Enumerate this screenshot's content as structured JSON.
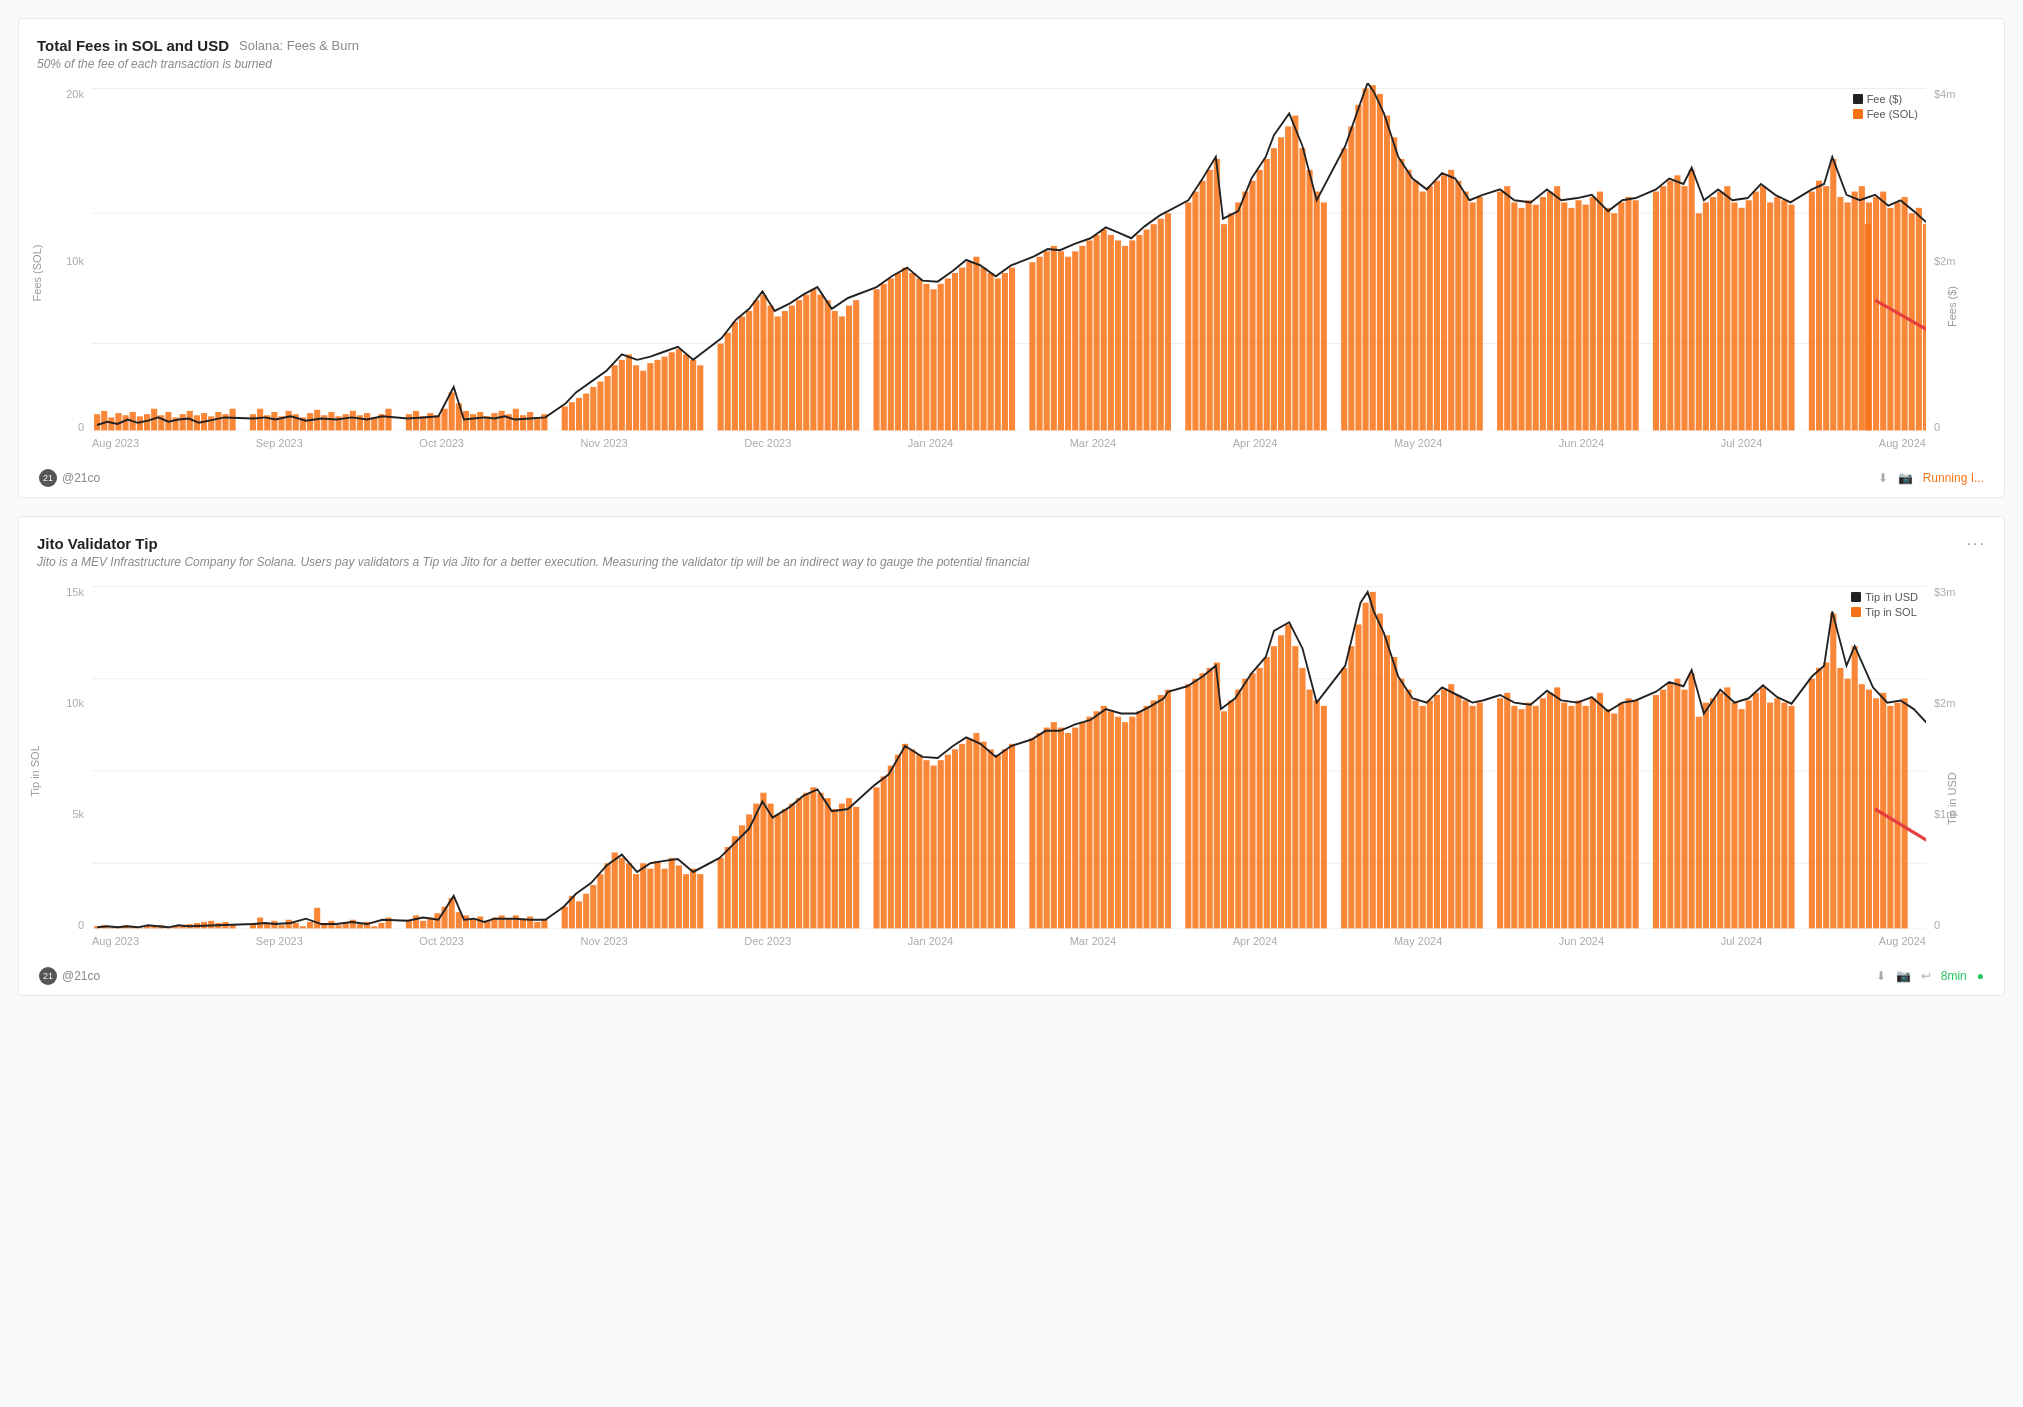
{
  "chart1": {
    "title": "Total Fees in SOL and USD",
    "tag": "Solana: Fees & Burn",
    "description": "50% of the fee of each transaction is burned",
    "yAxisLeft": {
      "label": "Fees (SOL)",
      "ticks": [
        "20k",
        "10k",
        "0"
      ]
    },
    "yAxisRight": {
      "label": "Fees ($)",
      "ticks": [
        "$4m",
        "$2m",
        "0"
      ]
    },
    "xAxisTicks": [
      "Aug 2023",
      "Sep 2023",
      "Oct 2023",
      "Nov 2023",
      "Dec 2023",
      "Jan 2024",
      "Mar 2024",
      "Apr 2024",
      "May 2024",
      "Jun 2024",
      "Jul 2024",
      "Aug 2024"
    ],
    "legend": {
      "item1": "Fee ($)",
      "item2": "Fee (SOL)"
    },
    "author": "@21co",
    "status": "Running I..."
  },
  "chart2": {
    "title": "Jito Validator Tip",
    "description": "Jito is a MEV Infrastructure Company for Solana. Users pay validators a Tip via Jito for a better execution. Measuring the validator tip will be an indirect way to gauge the potential financial",
    "yAxisLeft": {
      "label": "Tip in SOL",
      "ticks": [
        "15k",
        "10k",
        "5k",
        "0"
      ]
    },
    "yAxisRight": {
      "label": "Tip in USD",
      "ticks": [
        "$3m",
        "$2m",
        "$1m",
        "0"
      ]
    },
    "xAxisTicks": [
      "Aug 2023",
      "Sep 2023",
      "Oct 2023",
      "Nov 2023",
      "Dec 2023",
      "Jan 2024",
      "Mar 2024",
      "Apr 2024",
      "May 2024",
      "Jun 2024",
      "Jul 2024",
      "Aug 2024"
    ],
    "legend": {
      "item1": "Tip in USD",
      "item2": "Tip in SOL"
    },
    "author": "@21co",
    "status": "8min"
  }
}
